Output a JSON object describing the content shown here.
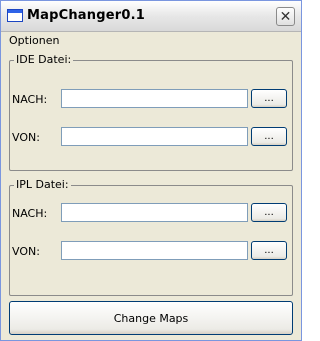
{
  "window": {
    "title": "MapChanger0.1",
    "close_symbol": "✕"
  },
  "menu": {
    "items": [
      {
        "label": "Optionen"
      }
    ]
  },
  "groups": [
    {
      "legend": "IDE Datei:",
      "rows": [
        {
          "label": "NACH:",
          "value": "",
          "button": "..."
        },
        {
          "label": "VON:",
          "value": "",
          "button": "..."
        }
      ]
    },
    {
      "legend": "IPL Datei:",
      "rows": [
        {
          "label": "NACH:",
          "value": "",
          "button": "..."
        },
        {
          "label": "VON:",
          "value": "",
          "button": "..."
        }
      ]
    }
  ],
  "action": {
    "label": "Change Maps"
  },
  "icons": {
    "app": "window-icon",
    "close": "close-icon"
  },
  "colors": {
    "window_bg": "#ece9d8",
    "input_border": "#7f9db9",
    "button_border": "#003c74"
  }
}
